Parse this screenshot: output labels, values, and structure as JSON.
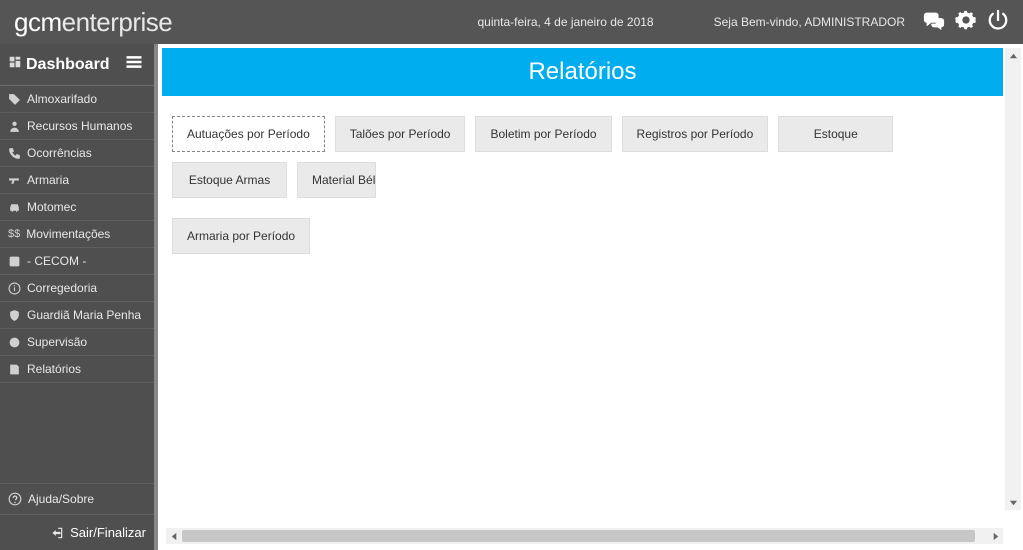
{
  "header": {
    "logo_prefix": "gcm",
    "logo_suffix": "enterprise",
    "date_text": "quinta-feira, 4 de janeiro de 2018",
    "welcome_text": "Seja Bem-vindo, ADMINISTRADOR"
  },
  "sidebar": {
    "title": "Dashboard",
    "items": [
      {
        "label": "Almoxarifado",
        "icon": "tag-icon"
      },
      {
        "label": "Recursos Humanos",
        "icon": "person-icon"
      },
      {
        "label": "Ocorrências",
        "icon": "phone-icon"
      },
      {
        "label": "Armaria",
        "icon": "gun-icon"
      },
      {
        "label": "Motomec",
        "icon": "car-icon"
      },
      {
        "label": "Movimentações",
        "icon": "dollar-icon"
      },
      {
        "label": "- CECOM -",
        "icon": "dispatch-icon"
      },
      {
        "label": "Corregedoria",
        "icon": "info-icon"
      },
      {
        "label": "Guardiã Maria Penha",
        "icon": "shield-icon"
      },
      {
        "label": "Supervisão",
        "icon": "badge-icon"
      },
      {
        "label": "Relatórios",
        "icon": "report-icon"
      }
    ],
    "help_label": "Ajuda/Sobre",
    "logout_label": "Sair/Finalizar"
  },
  "main": {
    "title": "Relatórios",
    "tabs_row1": [
      {
        "label": "Autuações por Período",
        "active": true
      },
      {
        "label": "Talões por Período"
      },
      {
        "label": "Boletim por Período"
      },
      {
        "label": "Registros por Período"
      },
      {
        "label": "Estoque"
      },
      {
        "label": "Estoque Armas"
      },
      {
        "label": "Material Bél",
        "cut": true
      }
    ],
    "tabs_row2": [
      {
        "label": "Armaria por Período"
      }
    ]
  }
}
